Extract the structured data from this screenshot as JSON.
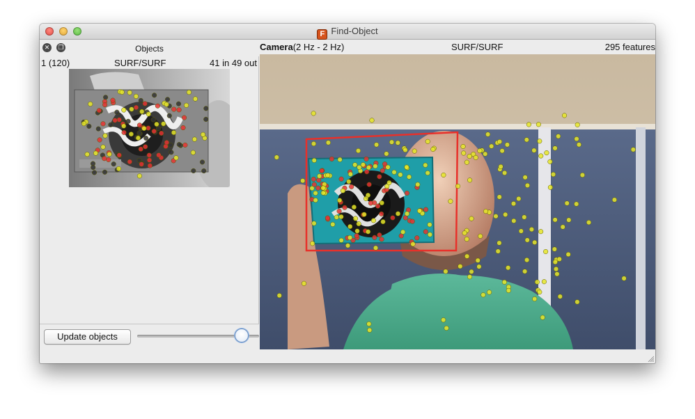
{
  "window": {
    "title": "Find-Object",
    "app_icon_letter": "F"
  },
  "objects_dock": {
    "title": "Objects",
    "object": {
      "id_label": "1 (120)",
      "detector": "SURF/SURF",
      "match_info": "41 in 49 out"
    },
    "update_button_label": "Update objects",
    "slider_value_fraction": 0.85
  },
  "camera": {
    "name": "Camera",
    "rate": "(2 Hz - 2 Hz)",
    "detector": "SURF/SURF",
    "features": "295 features"
  },
  "colors": {
    "feature_point": "#e6e62a",
    "matched_feature": "#e63232",
    "unmatched_feature": "#333333",
    "detection_box": "#e8302a"
  }
}
